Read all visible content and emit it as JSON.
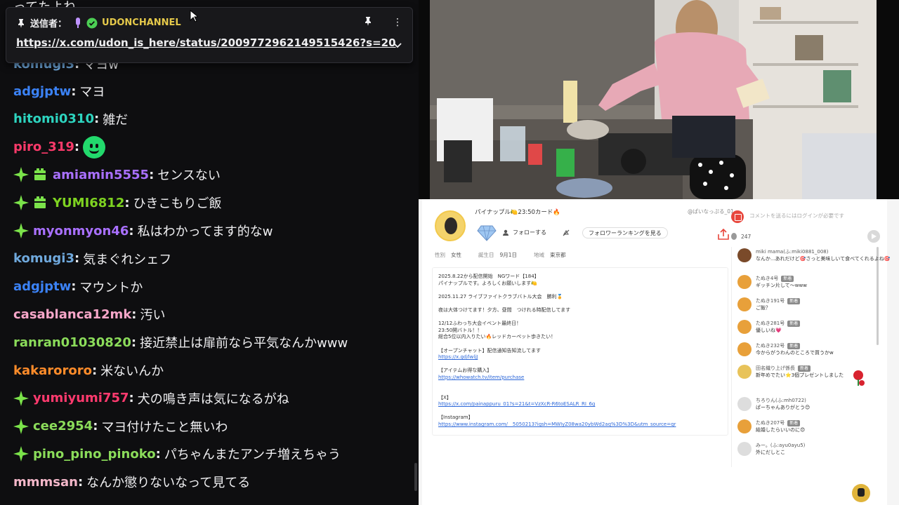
{
  "pinned": {
    "sender_label": "送信者：",
    "channel": "UDONCHANNEL",
    "link": "https://x.com/udon_is_here/status/2009772962149515426?s=20",
    "more_label": "⋮"
  },
  "chat": {
    "partial_top": "ってたよね",
    "partial_line": {
      "user": "komugi3",
      "msg": "マヨw"
    },
    "messages": [
      {
        "user": "adgjptw",
        "color": "#3b82f6",
        "msg": "マヨ",
        "badges": []
      },
      {
        "user": "hitomi0310",
        "color": "#2dd4bf",
        "msg": "雑だ",
        "badges": []
      },
      {
        "user": "piro_319",
        "color": "#fb3a6a",
        "msg": "",
        "badges": [],
        "emote": "smile-emote"
      },
      {
        "user": "amiamin5555",
        "color": "#a970ff",
        "msg": "センスない",
        "badges": [
          "spark",
          "sub"
        ]
      },
      {
        "user": "YUMI6812",
        "color": "#7ed321",
        "msg": "ひきこもりご飯",
        "badges": [
          "spark",
          "sub"
        ]
      },
      {
        "user": "myonmyon46",
        "color": "#a970ff",
        "msg": "私はわかってます的なw",
        "badges": [
          "spark"
        ]
      },
      {
        "user": "komugi3",
        "color": "#6fa8dc",
        "msg": "気まぐれシェフ",
        "badges": []
      },
      {
        "user": "adgjptw",
        "color": "#3b82f6",
        "msg": "マウントか",
        "badges": []
      },
      {
        "user": "casablanca12mk",
        "color": "#f7a6c9",
        "msg": "汚い",
        "badges": []
      },
      {
        "user": "ranran01030820",
        "color": "#8bdc5a",
        "msg": "接近禁止は扉前なら平気なんかwww",
        "badges": []
      },
      {
        "user": "kakarororo",
        "color": "#ff8c2a",
        "msg": "米ないんか",
        "badges": []
      },
      {
        "user": "yumiyumi757",
        "color": "#ff3a6e",
        "msg": "犬の鳴き声は気になるがね",
        "badges": [
          "spark"
        ]
      },
      {
        "user": "cee2954",
        "color": "#8bdc5a",
        "msg": "マヨ付けたこと無いわ",
        "badges": [
          "spark"
        ]
      },
      {
        "user": "pino_pino_pinoko",
        "color": "#8bdc5a",
        "msg": "パちゃんまたアンチ増えちゃう",
        "badges": [
          "spark"
        ]
      },
      {
        "user": "mmmsan",
        "color": "#f3b7c9",
        "msg": "なんか懲りないなって見てる",
        "badges": []
      }
    ]
  },
  "profile": {
    "name": "パイナップル🍋23:50カード🔥",
    "handle": "@ぱいなっぷる_01",
    "follow_label": "フォローする",
    "ranking_label": "フォロワーランキングを見る",
    "info": [
      {
        "k": "性別",
        "v": "女性"
      },
      {
        "k": "誕生日",
        "v": "9月1日"
      },
      {
        "k": "地域",
        "v": "東京都"
      }
    ],
    "bio": [
      "2025.8.22から配信開始　NGワード【184】",
      "パイナップルです。よろしくお願いします🍋",
      "",
      "2025.11.27 ライブファイトクラブバトル大会　勝利🏅",
      "",
      "夜は大体つけてます！夕方、昼間　つけれる時配信してます",
      "",
      "12/12ふわっち大会イベント最終日！",
      "23:50開バトル！！",
      "総合5位以内入りたい🔥レッドカーペット歩きたい！",
      "",
      "【オープンチャット】配信通知告知流してます",
      "https://x.gd/lwljJ",
      "",
      "【アイテムお得な購入】",
      "https://whowatch.tv/item/purchase",
      "",
      "",
      "【X】",
      "https://x.com/painappuru_01?s=21&t=VzXcR-R6toESALR_RI_6g",
      "",
      "【Instagram】",
      "https://www.instagram.com/__5050213?igsh=MWIyZ08wa20ybWd2aq%3D%3D&utm_source=qr"
    ]
  },
  "comments": {
    "placeholder": "コメントを送るにはログインが必要です",
    "viewer_count": "247",
    "items": [
      {
        "name": "miki mama(ふ:miki0881_008)",
        "text": "なんか...あれだけど🎯さっと美味しいて食べてくれるよね🎯",
        "tag": "",
        "color": "#7a4a2a"
      },
      {
        "name": "たぬき4号",
        "text": "ギッチン片して〜www",
        "tag": "新着",
        "color": "#e8a03a"
      },
      {
        "name": "たぬき191号",
        "text": "ご飯？",
        "tag": "新着",
        "color": "#e8a03a"
      },
      {
        "name": "たぬき281号",
        "text": "優しいね💗",
        "tag": "新着",
        "color": "#e8a03a"
      },
      {
        "name": "たぬき232号",
        "text": "今からがうわんのところで買うかw",
        "tag": "新着",
        "color": "#e8a03a"
      },
      {
        "name": "田名織り上げ係長",
        "text": "新年めでたい⭐3個プレゼントしました",
        "tag": "新着",
        "color": "#e8c35a"
      },
      {
        "name": "ちろりん(ふ:mh0722)",
        "text": "ぱーちゃんありがとう😊",
        "tag": "",
        "color": "#dddddd"
      },
      {
        "name": "たぬき207号",
        "text": "結婚したらいいのに😍",
        "tag": "新着",
        "color": "#e8a03a"
      },
      {
        "name": "みー。(ふ:ayu0ayu5)",
        "text": "外にだしとこ",
        "tag": "",
        "color": "#dddddd"
      }
    ]
  }
}
